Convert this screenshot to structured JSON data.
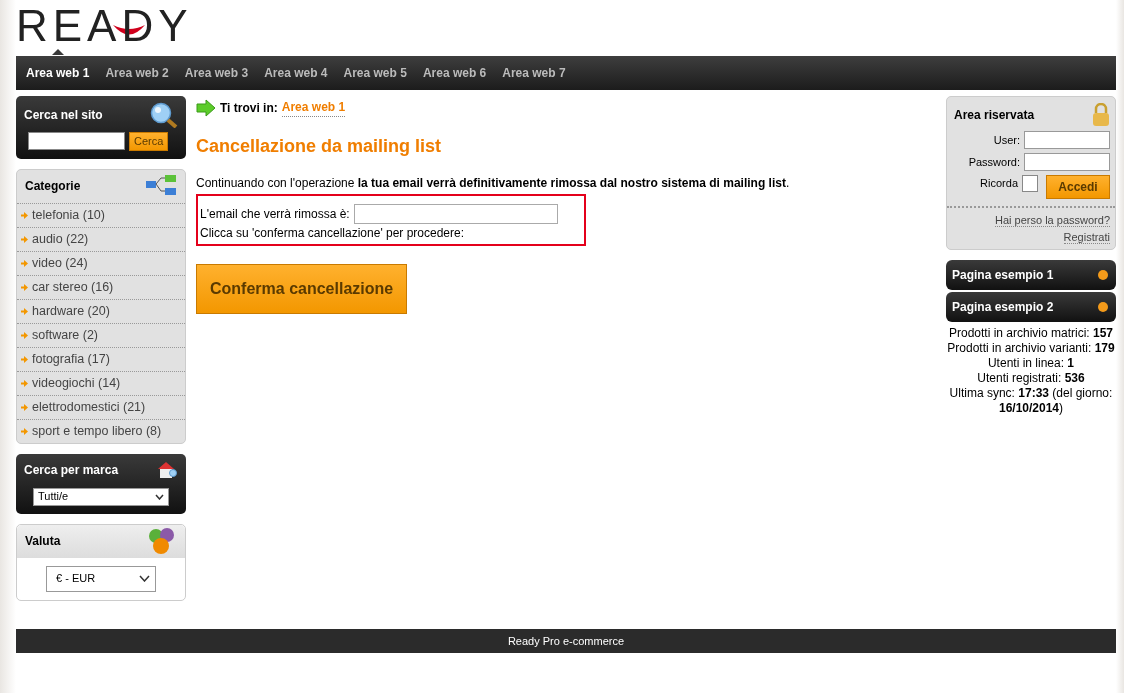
{
  "logo": {
    "text": "READY"
  },
  "nav": [
    {
      "label": "Area web 1",
      "selected": true
    },
    {
      "label": "Area web 2",
      "selected": false
    },
    {
      "label": "Area web 3",
      "selected": false
    },
    {
      "label": "Area web 4",
      "selected": false
    },
    {
      "label": "Area web 5",
      "selected": false
    },
    {
      "label": "Area web 6",
      "selected": false
    },
    {
      "label": "Area web 7",
      "selected": false
    }
  ],
  "site_search": {
    "title": "Cerca nel sito",
    "button": "Cerca"
  },
  "categories": {
    "title": "Categorie",
    "items": [
      "telefonia (10)",
      "audio (22)",
      "video (24)",
      "car stereo (16)",
      "hardware (20)",
      "software (2)",
      "fotografia (17)",
      "videogiochi (14)",
      "elettrodomestici (21)",
      "sport e tempo libero (8)"
    ]
  },
  "brand_search": {
    "title": "Cerca per marca",
    "value": "Tutti/e"
  },
  "currency": {
    "title": "Valuta",
    "value": "€ - EUR"
  },
  "breadcrumb": {
    "label": "Ti trovi in:",
    "link": "Area web 1"
  },
  "page_title": "Cancellazione da mailing list",
  "intro": "Continuando con l'operazione **la tua email verrà definitivamente rimossa dal nostro sistema di mailing list**.",
  "email_label": "L'email che verrà rimossa è:",
  "instruction": "Clicca su 'conferma cancellazione' per procedere:",
  "confirm_button": "Conferma cancellazione",
  "login": {
    "title": "Area riservata",
    "user_label": "User:",
    "password_label": "Password:",
    "remember_label": "Ricorda",
    "remember_checked": false,
    "button": "Accedi",
    "lost_password": "Hai perso la password?",
    "register": "Registrati"
  },
  "pages": [
    "Pagina esempio 1",
    "Pagina esempio 2"
  ],
  "stats": [
    "Prodotti in archivio matrici: **157**",
    "Prodotti in archivio varianti: **179**",
    "Utenti in linea: **1**",
    "Utenti registrati: **536**",
    "Ultima sync: **17:33** (del giorno: **16/10/2014**)"
  ],
  "footer": "Ready Pro e-commerce"
}
